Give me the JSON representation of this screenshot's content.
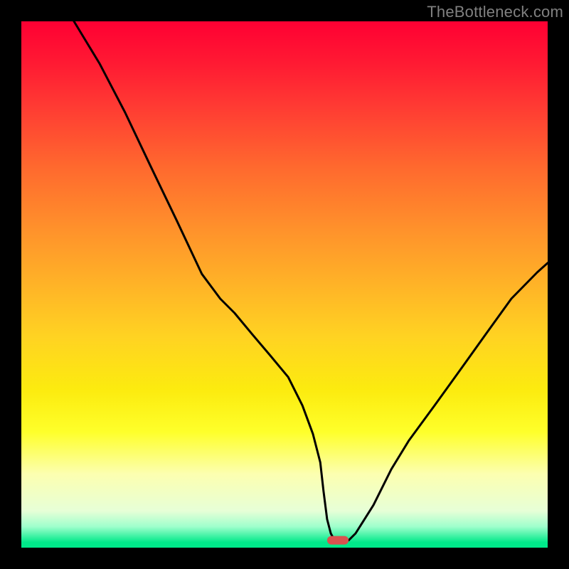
{
  "watermark": "TheBottleneck.com",
  "chart_data": {
    "type": "line",
    "title": "",
    "xlabel": "",
    "ylabel": "",
    "xlim": [
      0,
      100
    ],
    "ylim": [
      0,
      100
    ],
    "grid": false,
    "legend": false,
    "annotations": [],
    "background_gradient_stops": [
      {
        "pct": 0,
        "color": "#ff0033"
      },
      {
        "pct": 8,
        "color": "#ff1a33"
      },
      {
        "pct": 16,
        "color": "#ff3a33"
      },
      {
        "pct": 28,
        "color": "#ff6a2e"
      },
      {
        "pct": 40,
        "color": "#ff932b"
      },
      {
        "pct": 50,
        "color": "#ffb327"
      },
      {
        "pct": 60,
        "color": "#ffd322"
      },
      {
        "pct": 70,
        "color": "#fceb0f"
      },
      {
        "pct": 78,
        "color": "#feff2a"
      },
      {
        "pct": 86,
        "color": "#fcffb0"
      },
      {
        "pct": 93,
        "color": "#e7ffd7"
      },
      {
        "pct": 96,
        "color": "#9fffcc"
      },
      {
        "pct": 99,
        "color": "#00e98a"
      },
      {
        "pct": 100,
        "color": "#00e98a"
      }
    ],
    "series": [
      {
        "name": "bottleneck-curve",
        "color": "#000000",
        "x": [
          10.0,
          14.9,
          19.7,
          24.6,
          29.5,
          34.3,
          37.8,
          40.5,
          43.9,
          47.3,
          50.7,
          53.4,
          55.4,
          56.8,
          57.4,
          58.1,
          58.8,
          59.5,
          60.1,
          62.2,
          63.5,
          66.9,
          70.3,
          73.6,
          78.5,
          83.4,
          88.2,
          93.1,
          98.0,
          100.0
        ],
        "y": [
          100.0,
          91.9,
          82.7,
          72.4,
          62.2,
          52.0,
          47.3,
          44.6,
          40.5,
          36.5,
          32.4,
          27.0,
          21.6,
          16.2,
          10.8,
          5.4,
          2.7,
          1.4,
          1.4,
          1.4,
          2.7,
          8.1,
          14.9,
          20.3,
          27.0,
          33.8,
          40.5,
          47.3,
          52.3,
          54.1
        ]
      }
    ],
    "marker": {
      "name": "min-marker",
      "x_range": [
        58.1,
        62.2
      ],
      "y": 1.4,
      "color": "#d9534f",
      "shape": "capsule"
    }
  }
}
